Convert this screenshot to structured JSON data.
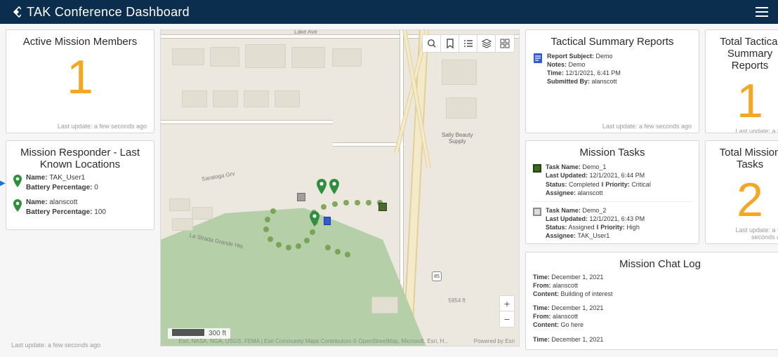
{
  "header": {
    "title": "TAK Conference Dashboard"
  },
  "timestamp_text": "Last update: a few seconds ago",
  "map": {
    "scale": "300 ft",
    "elevation": "5954 ft",
    "attribution": "Esri, NASA, NGA, USGS, FEMA | Esri Community Maps Contributors © OpenStreetMap, Microsoft, Esri, H...",
    "powered_by": "Powered by Esri",
    "lake_ave": "Lake Ave",
    "saratoga": "Saratoga Grv",
    "la_strada": "La Strada Grande Hts",
    "hwy_num": "85",
    "poi_sally1": "Sally Beauty",
    "poi_sally2": "Supply"
  },
  "active_members": {
    "title": "Active Mission Members",
    "count": "1"
  },
  "total_reports": {
    "title": "Total Tactical Summary Reports",
    "count": "1"
  },
  "total_tasks": {
    "title": "Total Mission Tasks",
    "count": "2"
  },
  "responder": {
    "title": "Mission Responder - Last Known Locations",
    "items": [
      {
        "name": "TAK_User1",
        "battery": "0"
      },
      {
        "name": "alanscott",
        "battery": "100"
      }
    ]
  },
  "reports_panel": {
    "title": "Tactical Summary Reports",
    "items": [
      {
        "subject": "Demo",
        "notes": "Demo",
        "time": "12/1/2021, 6:41 PM",
        "submitted_by": "alanscott"
      }
    ]
  },
  "tasks_panel": {
    "title": "Mission Tasks",
    "items": [
      {
        "name": "Demo_1",
        "updated": "12/1/2021, 6:44 PM",
        "status": "Completed",
        "priority": "Critical",
        "assignee": "alanscott",
        "sq_class": "completed"
      },
      {
        "name": "Demo_2",
        "updated": "12/1/2021, 6:43 PM",
        "status": "Assigned",
        "priority": "High",
        "assignee": "TAK_User1",
        "sq_class": "assigned"
      }
    ]
  },
  "chat": {
    "title": "Mission Chat Log",
    "entries": [
      {
        "time": "December 1, 2021",
        "from": "alanscott",
        "content": "Building of interest"
      },
      {
        "time": "December 1, 2021",
        "from": "alanscott",
        "content": "Go here"
      },
      {
        "time": "December 1, 2021",
        "from": "",
        "content": ""
      }
    ]
  },
  "labels": {
    "name": "Name:",
    "battery": "Battery Percentage:",
    "report_subject": "Report Subject:",
    "notes": "Notes:",
    "time": "Time:",
    "submitted_by": "Submitted By:",
    "task_name": "Task Name:",
    "last_updated": "Last Updated:",
    "status": "Status:",
    "priority": "Priority:",
    "assignee": "Assignee:",
    "from": "From:",
    "content": "Content:"
  }
}
